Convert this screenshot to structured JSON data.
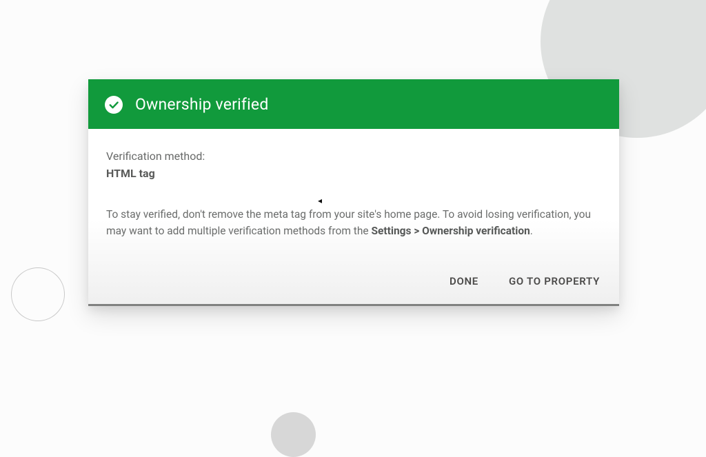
{
  "header": {
    "title": "Ownership verified"
  },
  "body": {
    "method_label": "Verification method:",
    "method_value": "HTML tag",
    "info_prefix": "To stay verified, don't remove the meta tag from your site's home page. To avoid losing verification, you may want to add multiple verification methods from the ",
    "settings_path": "Settings > Ownership verification",
    "info_suffix": "."
  },
  "actions": {
    "done_label": "DONE",
    "go_to_property_label": "GO TO PROPERTY"
  },
  "colors": {
    "header_bg": "#119a3c"
  }
}
